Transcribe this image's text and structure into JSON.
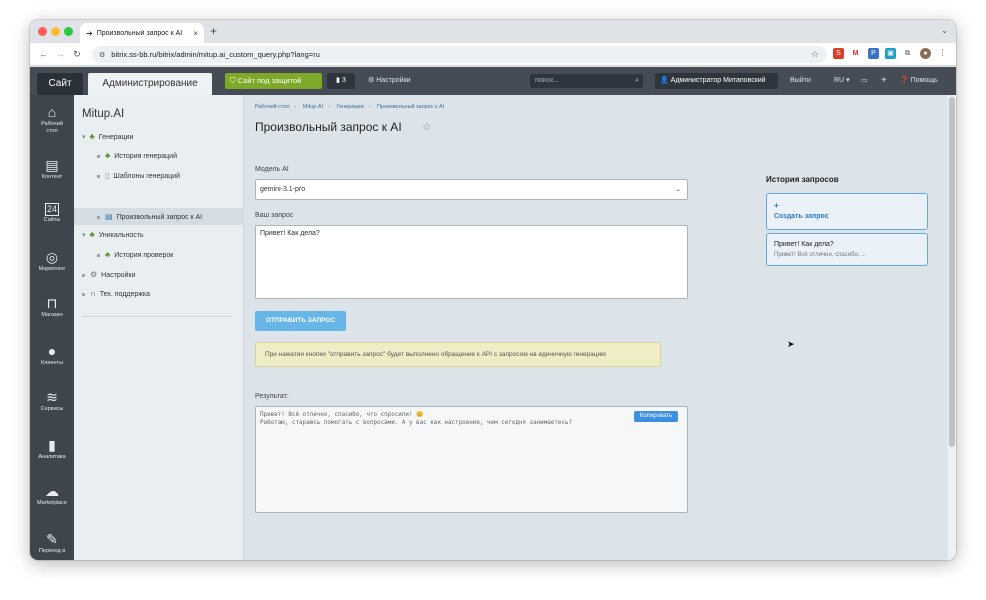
{
  "browser": {
    "tab_title": "Произвольный запрос к AI",
    "url": "bitrix.ss-bb.ru/bitrix/admin/mitup.ai_custom_query.php?lang=ru"
  },
  "header": {
    "site": "Сайт",
    "admin": "Администрирование",
    "protected_site": "Сайт под защитой",
    "notifications_count": "3",
    "settings": "Настройки",
    "search_placeholder": "поиск...",
    "user": "Администратор Митаповский",
    "logout": "Выйти",
    "lang": "RU",
    "help": "Помощь"
  },
  "iconbar": [
    {
      "label": "Рабочий стол",
      "icon": "home-icon",
      "glyph": "⌂"
    },
    {
      "label": "Контент",
      "icon": "content-icon",
      "glyph": "▤"
    },
    {
      "label": "Сайты",
      "icon": "calendar-icon",
      "glyph": "24"
    },
    {
      "label": "Маркетинг",
      "icon": "target-icon",
      "glyph": "◎"
    },
    {
      "label": "Магазин",
      "icon": "basket-icon",
      "glyph": "⊓"
    },
    {
      "label": "Клиенты",
      "icon": "clients-icon",
      "glyph": "●"
    },
    {
      "label": "Сервисы",
      "icon": "layers-icon",
      "glyph": "≋"
    },
    {
      "label": "Аналитика",
      "icon": "analytics-icon",
      "glyph": "▮"
    },
    {
      "label": "Marketplace",
      "icon": "cloud-icon",
      "glyph": "☁"
    },
    {
      "label": "Переход в",
      "icon": "edit-icon",
      "glyph": "✎"
    }
  ],
  "tree": {
    "title": "Mitup.AI",
    "items": [
      {
        "label": "Генерации"
      },
      {
        "label": "История генераций"
      },
      {
        "label": "Шаблоны генераций"
      },
      {
        "label": "Произвольный запрос к AI"
      },
      {
        "label": "Уникальность"
      },
      {
        "label": "История проверок"
      },
      {
        "label": "Настройки"
      },
      {
        "label": "Тех. поддержка"
      }
    ]
  },
  "breadcrumbs": [
    "Рабочий стол",
    "Mitup.AI",
    "Генерации",
    "Произвольный запрос к AI"
  ],
  "page_title": "Произвольный запрос к AI",
  "form": {
    "model_label": "Модель AI",
    "model_value": "gemini-3.1-pro",
    "query_label": "Ваш запрос",
    "query_value": "Привет! Как дела?",
    "send_button": "ОТПРАВИТЬ ЗАПРОС",
    "notice": "При нажатии кнопки \"отправить запрос\" будет выполнено обращение к API с запросом на единичную генерацию",
    "result_label": "Результат:",
    "result_text": "Привет! Всё отлично, спасибо, что спросили! 😊\nРаботаю, стараюсь помогать с вопросами. А у вас как настроение, чем сегодня занимаетесь?",
    "copy_button": "Копировать"
  },
  "history": {
    "title": "История запросов",
    "create_plus": "+",
    "create_label": "Создать запрос",
    "items": [
      {
        "query": "Привет! Как дела?",
        "answer": "Привет! Всё отлично, спасибо, ..."
      }
    ]
  }
}
